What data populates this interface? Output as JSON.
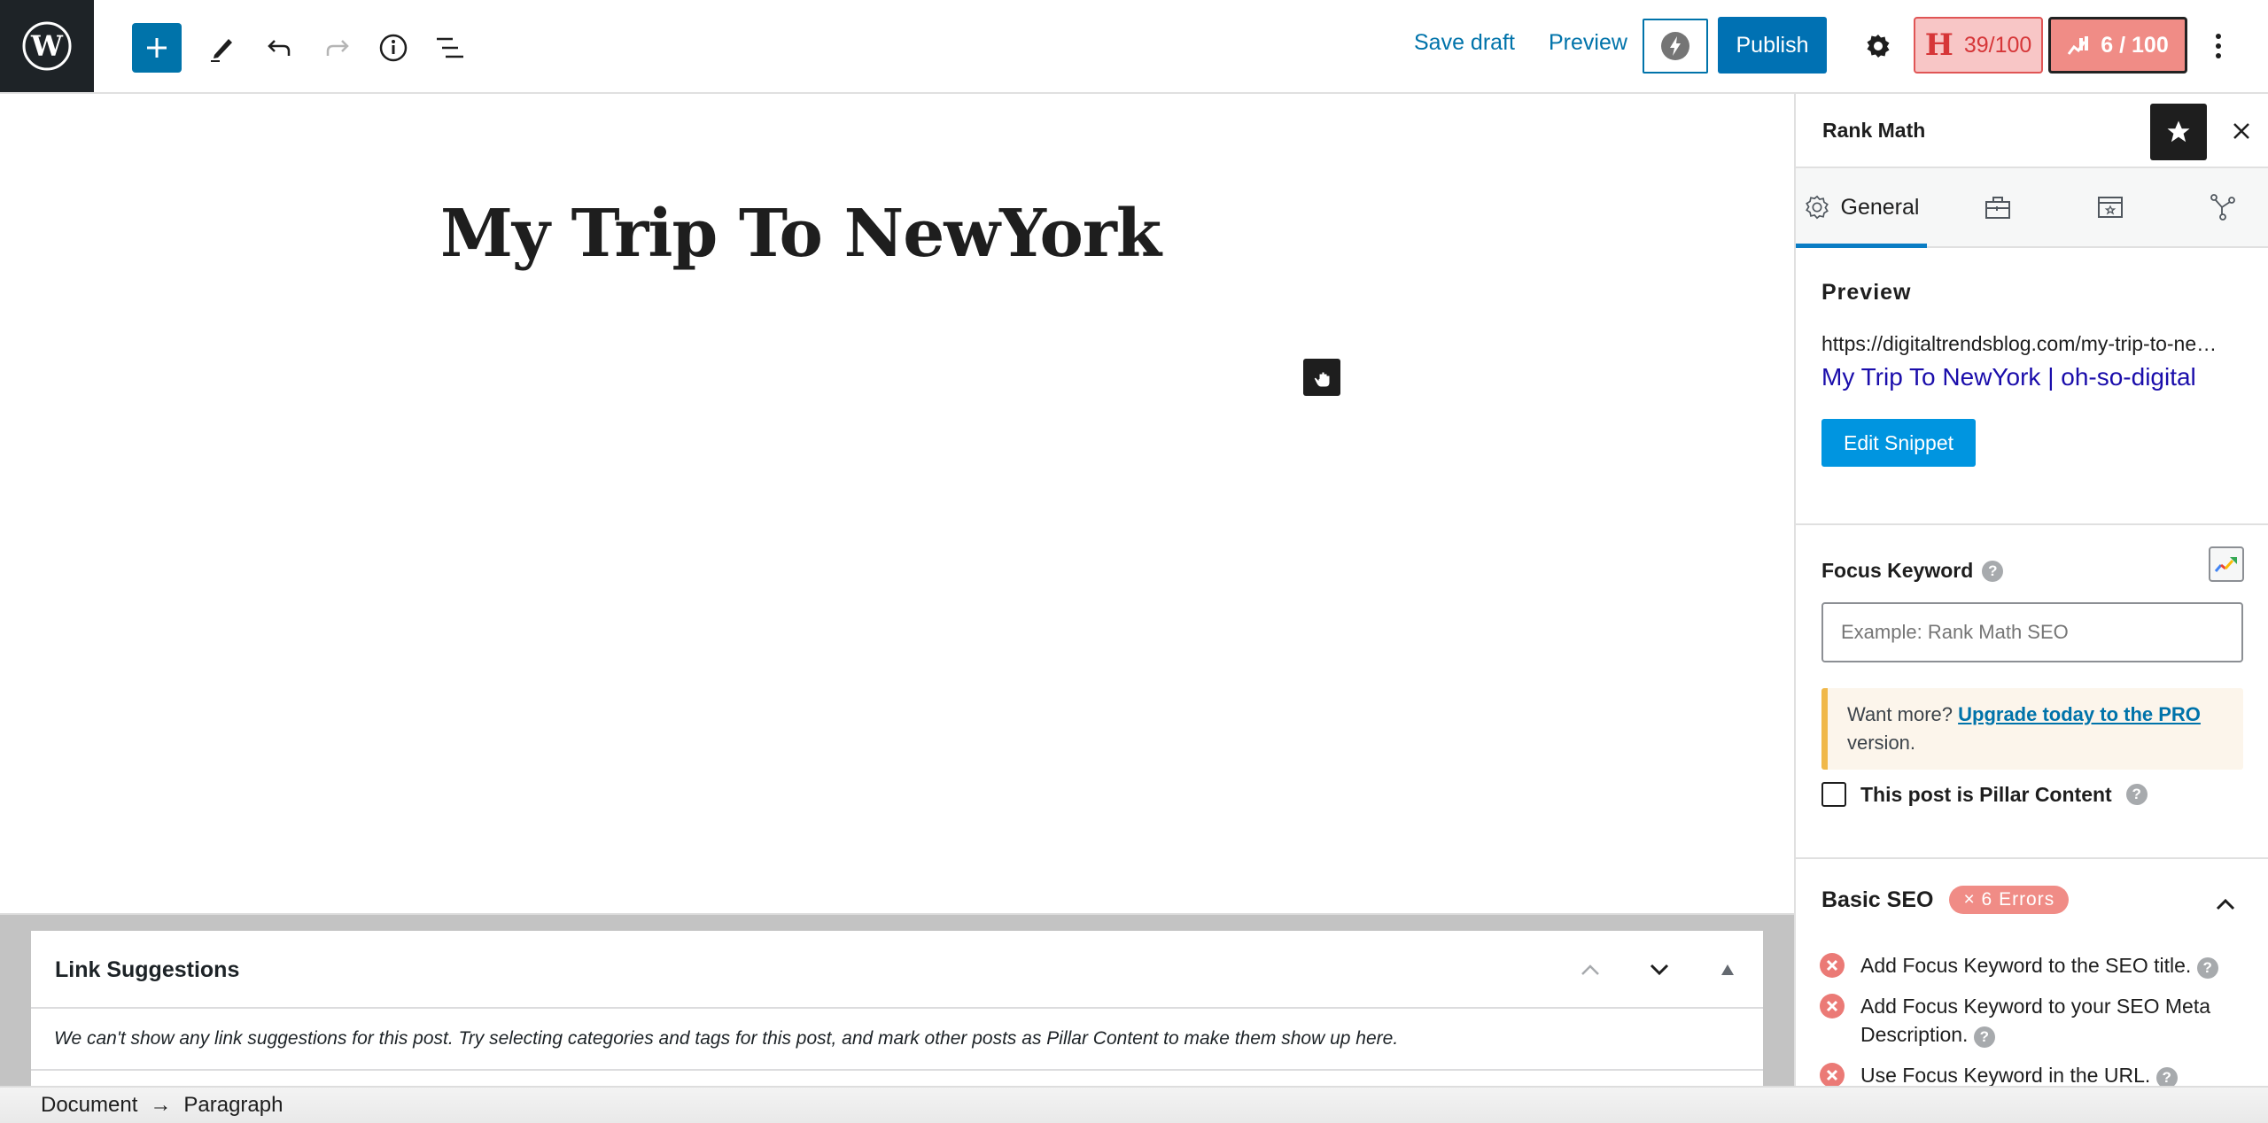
{
  "toolbar": {
    "save_draft": "Save draft",
    "preview": "Preview",
    "publish": "Publish",
    "headline_score": "39/100",
    "headline_score_icon": "H",
    "rankmath_score": "6 / 100",
    "icons": [
      "wordpress-logo",
      "plus-icon",
      "pencil-icon",
      "undo-icon",
      "redo-icon",
      "info-icon",
      "list-view-icon",
      "amp-bolt-icon",
      "gear-icon",
      "rank-math-icon",
      "more-vertical-icon"
    ]
  },
  "editor": {
    "post_title": "My Trip To NewYork"
  },
  "metabox": {
    "title": "Link Suggestions",
    "message": "We can't show any link suggestions for this post. Try selecting categories and tags for this post, and mark other posts as Pillar Content to make them show up here."
  },
  "footer": {
    "breadcrumb": [
      "Document",
      "Paragraph"
    ],
    "separator": "→"
  },
  "sidebar": {
    "title": "Rank Math",
    "tabs": [
      {
        "label": "General",
        "icon": "gear-icon",
        "active": true
      },
      {
        "label": "",
        "icon": "toolbox-icon",
        "active": false
      },
      {
        "label": "",
        "icon": "schema-icon",
        "active": false
      },
      {
        "label": "",
        "icon": "social-icon",
        "active": false
      }
    ],
    "preview": {
      "heading": "Preview",
      "url": "https://digitaltrendsblog.com/my-trip-to-newyork/",
      "title": "My Trip To NewYork | oh-so-digital",
      "edit_button": "Edit Snippet"
    },
    "focus_keyword": {
      "label": "Focus Keyword",
      "placeholder": "Example: Rank Math SEO",
      "value": "",
      "upgrade_prefix": "Want more? ",
      "upgrade_link": "Upgrade today to the PRO",
      "upgrade_suffix": " version.",
      "pillar_label": "This post is Pillar Content",
      "pillar_checked": false
    },
    "basic_seo": {
      "title": "Basic SEO",
      "badge": "× 6 Errors",
      "items": [
        "Add Focus Keyword to the SEO title.",
        "Add Focus Keyword to your SEO Meta Description.",
        "Use Focus Keyword in the URL."
      ]
    }
  },
  "colors": {
    "wp_blue": "#0073aa",
    "error_red": "#f08c86",
    "snippet_link": "#1a0dab",
    "notice_border": "#f0b849"
  }
}
